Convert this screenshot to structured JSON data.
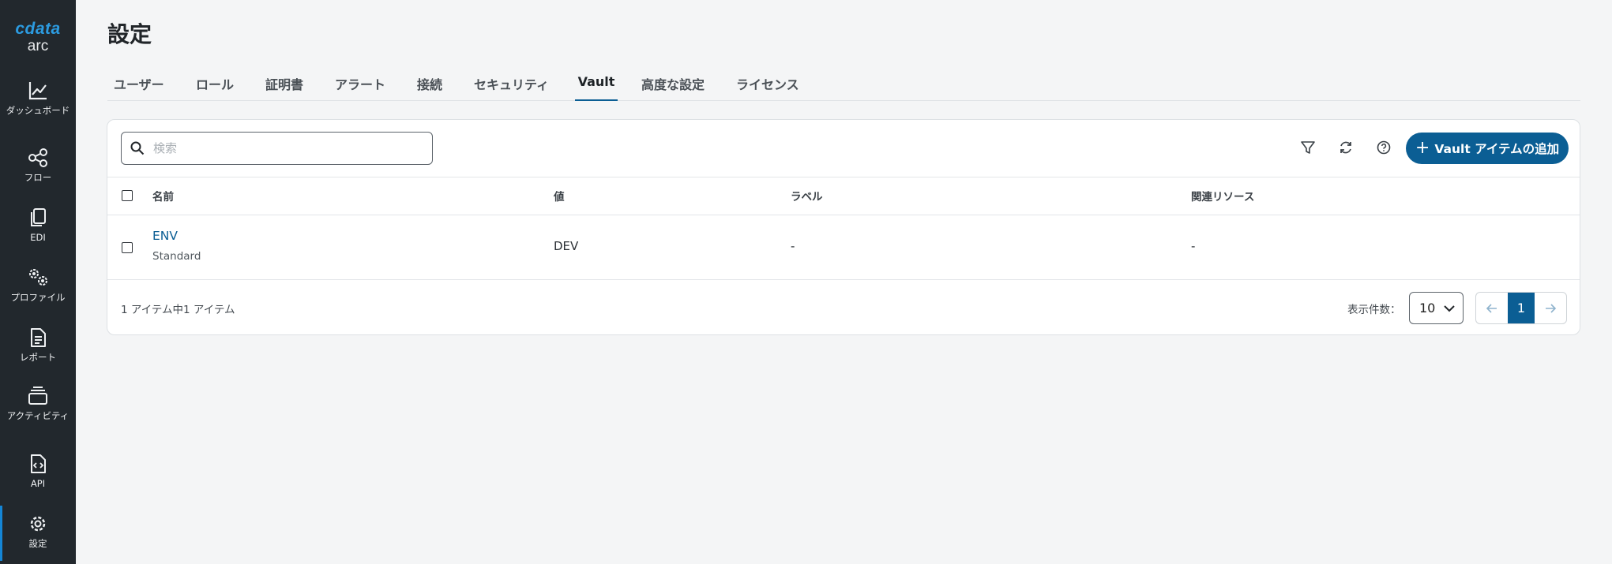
{
  "brand": {
    "name": "cdata",
    "product": "arc"
  },
  "sidebar": {
    "items": [
      {
        "label": "ダッシュボード",
        "icon": "chart-line-icon"
      },
      {
        "label": "フロー",
        "icon": "flow-nodes-icon"
      },
      {
        "label": "EDI",
        "icon": "documents-copy-icon"
      },
      {
        "label": "プロファイル",
        "icon": "gears-icon"
      },
      {
        "label": "レポート",
        "icon": "report-document-icon"
      },
      {
        "label": "アクティビティ",
        "icon": "activity-stack-icon"
      },
      {
        "label": "API",
        "icon": "api-code-file-icon"
      },
      {
        "label": "設定",
        "icon": "gear-icon",
        "active": true
      }
    ]
  },
  "page": {
    "title": "設定"
  },
  "tabs": [
    {
      "label": "ユーザー"
    },
    {
      "label": "ロール"
    },
    {
      "label": "証明書"
    },
    {
      "label": "アラート"
    },
    {
      "label": "接続"
    },
    {
      "label": "セキュリティ"
    },
    {
      "label": "Vault",
      "active": true
    },
    {
      "label": "高度な設定"
    },
    {
      "label": "ライセンス"
    }
  ],
  "toolbar": {
    "search_placeholder": "検索",
    "search_value": "",
    "add_button_label": "Vault アイテムの追加",
    "icons": [
      "filter-icon",
      "refresh-icon",
      "help-icon"
    ]
  },
  "table": {
    "columns": [
      "名前",
      "値",
      "ラベル",
      "関連リソース"
    ],
    "rows": [
      {
        "name": "ENV",
        "type": "Standard",
        "value": "DEV",
        "label": "-",
        "related": "-"
      }
    ]
  },
  "footer": {
    "count_text": "1 アイテム中1 アイテム",
    "per_page_label": "表示件数：",
    "per_page_value": "10",
    "current_page": "1"
  },
  "colors": {
    "accent": "#0b5e94",
    "sidebar_bg": "#22282d",
    "brand": "#2c9be0"
  }
}
